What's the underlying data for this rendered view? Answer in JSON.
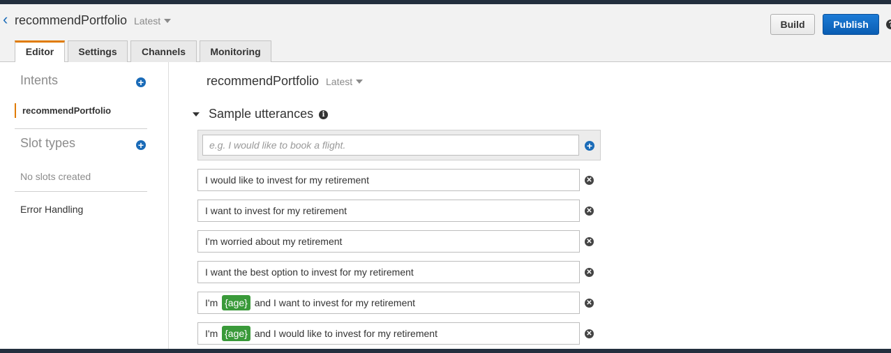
{
  "header": {
    "bot_name": "recommendPortfolio",
    "version": "Latest",
    "build_label": "Build",
    "publish_label": "Publish",
    "help_glyph": "?"
  },
  "tabs": [
    {
      "label": "Editor",
      "active": true
    },
    {
      "label": "Settings",
      "active": false
    },
    {
      "label": "Channels",
      "active": false
    },
    {
      "label": "Monitoring",
      "active": false
    }
  ],
  "sidebar": {
    "intents_heading": "Intents",
    "intents": [
      "recommendPortfolio"
    ],
    "slot_types_heading": "Slot types",
    "no_slots_text": "No slots created",
    "error_handling_label": "Error Handling"
  },
  "main": {
    "intent_name": "recommendPortfolio",
    "version": "Latest",
    "section_title": "Sample utterances",
    "placeholder": "e.g. I would like to book a flight.",
    "utterances": [
      {
        "before": "I would like to invest for my retirement"
      },
      {
        "before": "I want to invest for my retirement"
      },
      {
        "before": "I'm worried about my retirement"
      },
      {
        "before": "I want the best option to invest for my retirement"
      },
      {
        "before": "I'm",
        "slot": "{age}",
        "after": "and I want to invest for my retirement"
      },
      {
        "before": "I'm",
        "slot": "{age}",
        "after": "and I would like to invest for my retirement"
      }
    ]
  },
  "colors": {
    "accent_orange": "#e07b00",
    "publish_blue": "#0a5db3",
    "slot_green": "#3a9a3a",
    "link_blue": "#1a6bb8"
  }
}
